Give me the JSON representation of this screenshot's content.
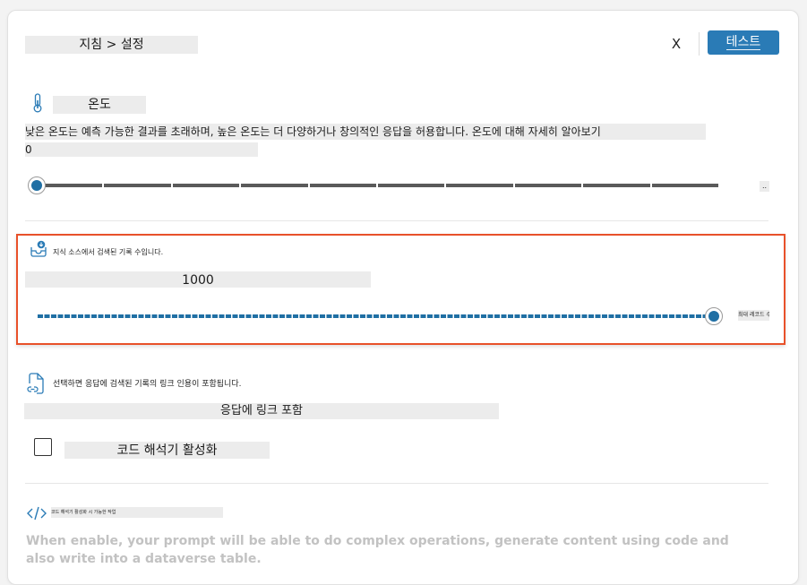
{
  "header": {
    "breadcrumb": "지침 > 설정",
    "close_label": "X",
    "test_button_label": "테스트"
  },
  "temperature": {
    "icon": "thermometer-icon",
    "title": "온도",
    "description": "낮은 온도는 예측 가능한 결과를 초래하며, 높은 온도는 더 다양하거나 창의적인 응답을 허용합니다. 온도에 대해 자세히 알아보기",
    "value": "0",
    "slider_end_label": "..",
    "slider_level": 0
  },
  "records": {
    "icon": "download-tray-icon",
    "description": "지식 소스에서 검색된 기록 수입니다.",
    "value": "1000",
    "slider_end_label": "최대 레코드 수",
    "slider_level": 1
  },
  "citations": {
    "icon": "link-document-icon",
    "description": "선택하면 응답에 검색된 기록의 링크 인용이 포함됩니다.",
    "toggle_label": "응답에 링크 포함"
  },
  "code_interpreter": {
    "checkbox_label": "코드 해석기 활성화",
    "checked": false,
    "icon": "code-icon",
    "heading": "코드 해석기 활성화 시 가능한 작업",
    "description": "When enable, your prompt will be able to do complex operations, generate content using code and also write into a dataverse table."
  },
  "colors": {
    "accent": "#2a7bb6",
    "slider_fill": "#1f6fa4",
    "highlight_border": "#e8512a",
    "disabled_text": "#c2c2c2"
  }
}
